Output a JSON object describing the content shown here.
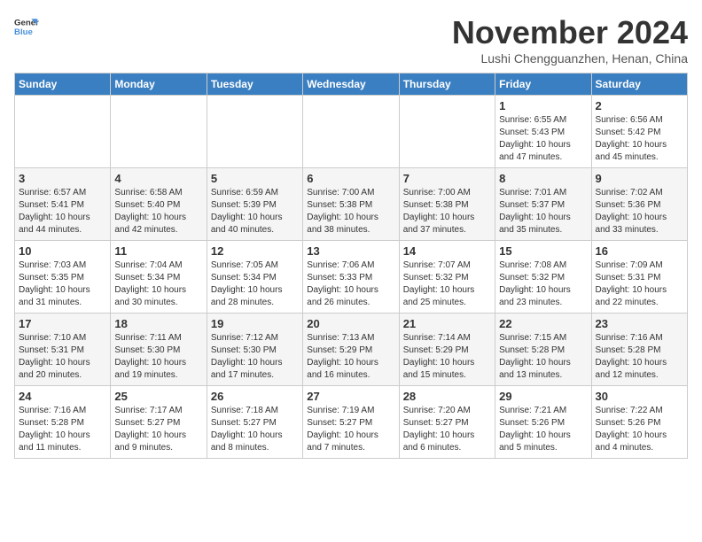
{
  "logo": {
    "line1": "General",
    "line2": "Blue"
  },
  "title": "November 2024",
  "location": "Lushi Chengguanzhen, Henan, China",
  "days_of_week": [
    "Sunday",
    "Monday",
    "Tuesday",
    "Wednesday",
    "Thursday",
    "Friday",
    "Saturday"
  ],
  "weeks": [
    [
      {
        "day": "",
        "info": ""
      },
      {
        "day": "",
        "info": ""
      },
      {
        "day": "",
        "info": ""
      },
      {
        "day": "",
        "info": ""
      },
      {
        "day": "",
        "info": ""
      },
      {
        "day": "1",
        "info": "Sunrise: 6:55 AM\nSunset: 5:43 PM\nDaylight: 10 hours\nand 47 minutes."
      },
      {
        "day": "2",
        "info": "Sunrise: 6:56 AM\nSunset: 5:42 PM\nDaylight: 10 hours\nand 45 minutes."
      }
    ],
    [
      {
        "day": "3",
        "info": "Sunrise: 6:57 AM\nSunset: 5:41 PM\nDaylight: 10 hours\nand 44 minutes."
      },
      {
        "day": "4",
        "info": "Sunrise: 6:58 AM\nSunset: 5:40 PM\nDaylight: 10 hours\nand 42 minutes."
      },
      {
        "day": "5",
        "info": "Sunrise: 6:59 AM\nSunset: 5:39 PM\nDaylight: 10 hours\nand 40 minutes."
      },
      {
        "day": "6",
        "info": "Sunrise: 7:00 AM\nSunset: 5:38 PM\nDaylight: 10 hours\nand 38 minutes."
      },
      {
        "day": "7",
        "info": "Sunrise: 7:00 AM\nSunset: 5:38 PM\nDaylight: 10 hours\nand 37 minutes."
      },
      {
        "day": "8",
        "info": "Sunrise: 7:01 AM\nSunset: 5:37 PM\nDaylight: 10 hours\nand 35 minutes."
      },
      {
        "day": "9",
        "info": "Sunrise: 7:02 AM\nSunset: 5:36 PM\nDaylight: 10 hours\nand 33 minutes."
      }
    ],
    [
      {
        "day": "10",
        "info": "Sunrise: 7:03 AM\nSunset: 5:35 PM\nDaylight: 10 hours\nand 31 minutes."
      },
      {
        "day": "11",
        "info": "Sunrise: 7:04 AM\nSunset: 5:34 PM\nDaylight: 10 hours\nand 30 minutes."
      },
      {
        "day": "12",
        "info": "Sunrise: 7:05 AM\nSunset: 5:34 PM\nDaylight: 10 hours\nand 28 minutes."
      },
      {
        "day": "13",
        "info": "Sunrise: 7:06 AM\nSunset: 5:33 PM\nDaylight: 10 hours\nand 26 minutes."
      },
      {
        "day": "14",
        "info": "Sunrise: 7:07 AM\nSunset: 5:32 PM\nDaylight: 10 hours\nand 25 minutes."
      },
      {
        "day": "15",
        "info": "Sunrise: 7:08 AM\nSunset: 5:32 PM\nDaylight: 10 hours\nand 23 minutes."
      },
      {
        "day": "16",
        "info": "Sunrise: 7:09 AM\nSunset: 5:31 PM\nDaylight: 10 hours\nand 22 minutes."
      }
    ],
    [
      {
        "day": "17",
        "info": "Sunrise: 7:10 AM\nSunset: 5:31 PM\nDaylight: 10 hours\nand 20 minutes."
      },
      {
        "day": "18",
        "info": "Sunrise: 7:11 AM\nSunset: 5:30 PM\nDaylight: 10 hours\nand 19 minutes."
      },
      {
        "day": "19",
        "info": "Sunrise: 7:12 AM\nSunset: 5:30 PM\nDaylight: 10 hours\nand 17 minutes."
      },
      {
        "day": "20",
        "info": "Sunrise: 7:13 AM\nSunset: 5:29 PM\nDaylight: 10 hours\nand 16 minutes."
      },
      {
        "day": "21",
        "info": "Sunrise: 7:14 AM\nSunset: 5:29 PM\nDaylight: 10 hours\nand 15 minutes."
      },
      {
        "day": "22",
        "info": "Sunrise: 7:15 AM\nSunset: 5:28 PM\nDaylight: 10 hours\nand 13 minutes."
      },
      {
        "day": "23",
        "info": "Sunrise: 7:16 AM\nSunset: 5:28 PM\nDaylight: 10 hours\nand 12 minutes."
      }
    ],
    [
      {
        "day": "24",
        "info": "Sunrise: 7:16 AM\nSunset: 5:28 PM\nDaylight: 10 hours\nand 11 minutes."
      },
      {
        "day": "25",
        "info": "Sunrise: 7:17 AM\nSunset: 5:27 PM\nDaylight: 10 hours\nand 9 minutes."
      },
      {
        "day": "26",
        "info": "Sunrise: 7:18 AM\nSunset: 5:27 PM\nDaylight: 10 hours\nand 8 minutes."
      },
      {
        "day": "27",
        "info": "Sunrise: 7:19 AM\nSunset: 5:27 PM\nDaylight: 10 hours\nand 7 minutes."
      },
      {
        "day": "28",
        "info": "Sunrise: 7:20 AM\nSunset: 5:27 PM\nDaylight: 10 hours\nand 6 minutes."
      },
      {
        "day": "29",
        "info": "Sunrise: 7:21 AM\nSunset: 5:26 PM\nDaylight: 10 hours\nand 5 minutes."
      },
      {
        "day": "30",
        "info": "Sunrise: 7:22 AM\nSunset: 5:26 PM\nDaylight: 10 hours\nand 4 minutes."
      }
    ]
  ]
}
